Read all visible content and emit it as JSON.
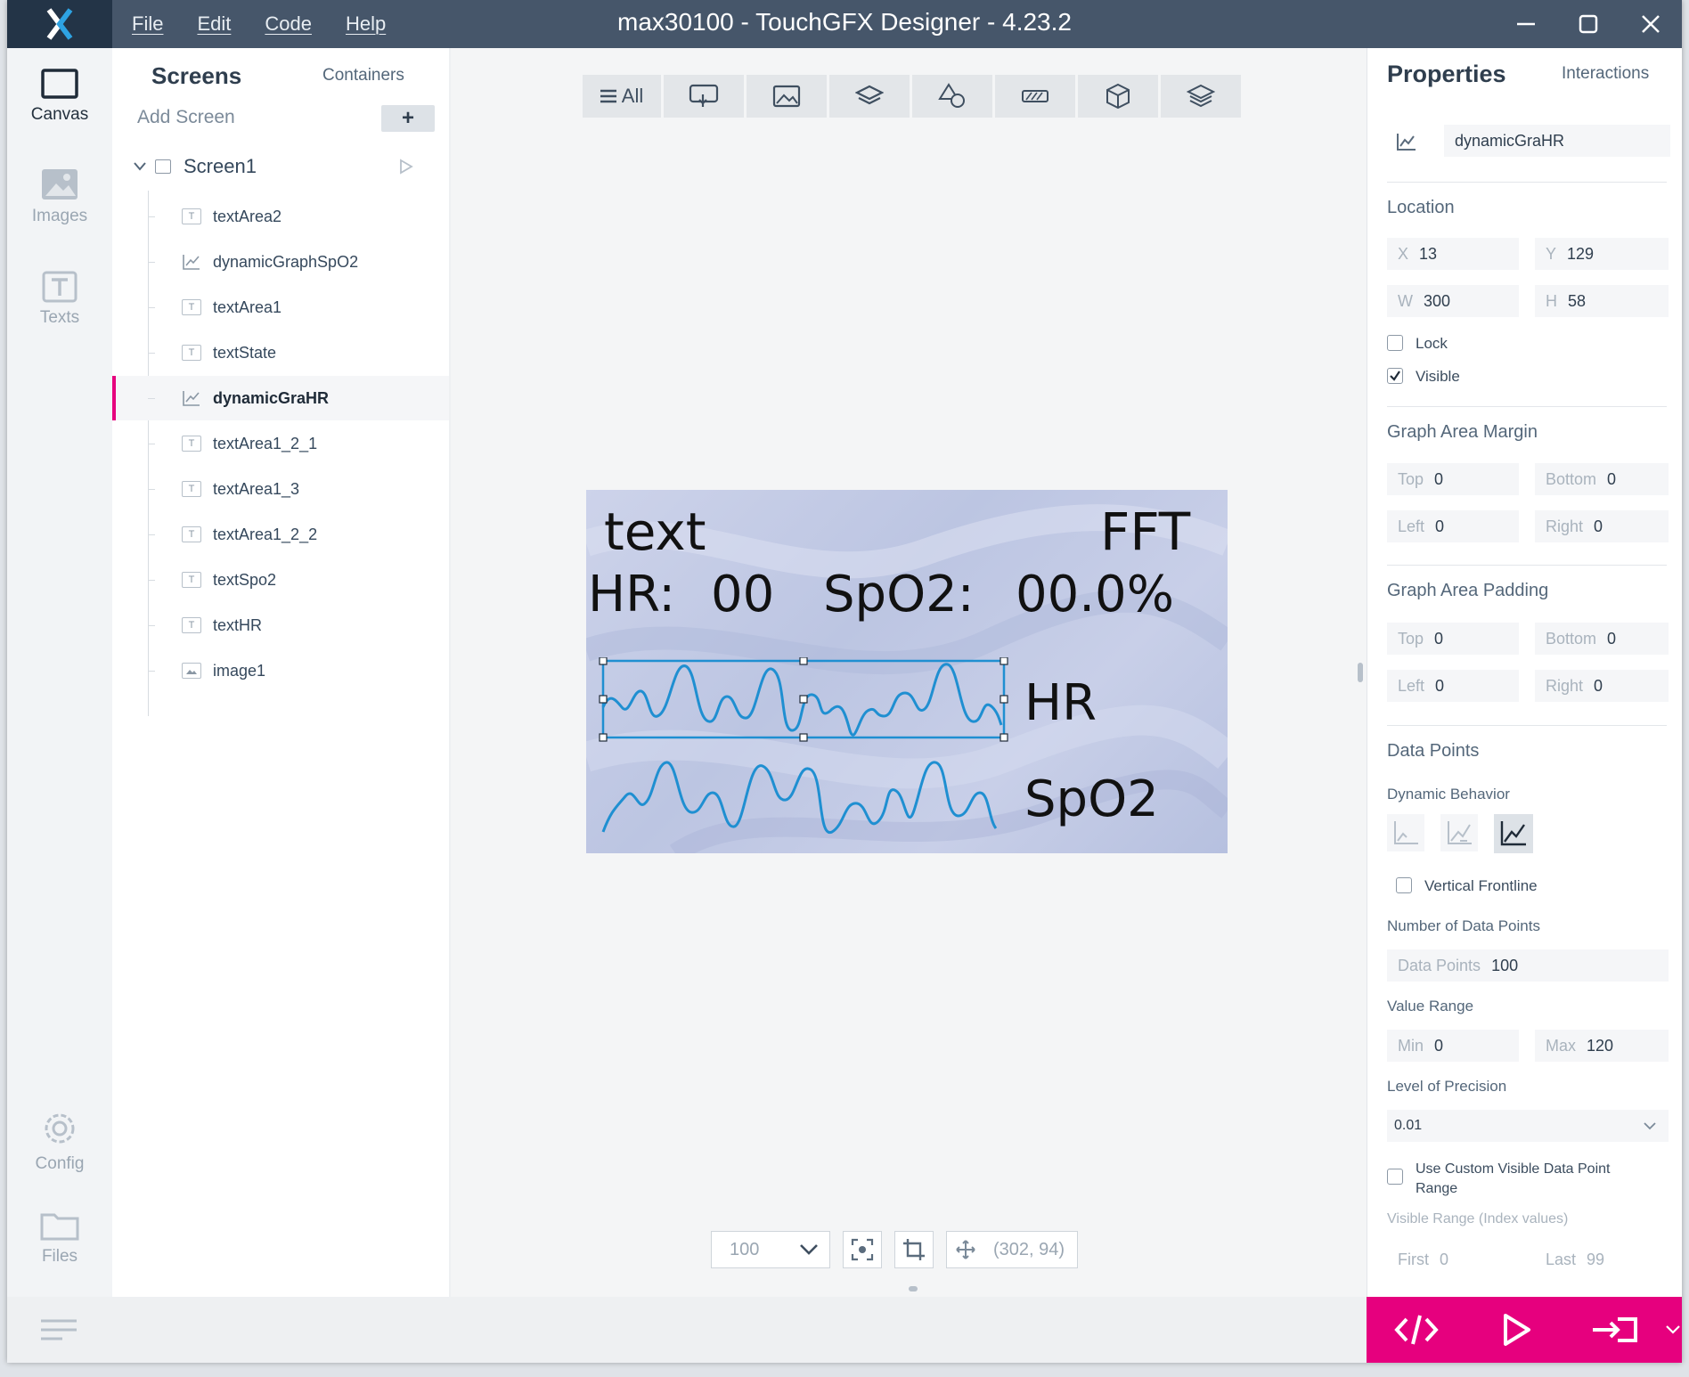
{
  "window": {
    "title": "max30100 - TouchGFX Designer - 4.23.2",
    "menu": [
      "File",
      "Edit",
      "Code",
      "Help"
    ]
  },
  "rail": {
    "canvas": "Canvas",
    "images": "Images",
    "texts": "Texts",
    "config": "Config",
    "files": "Files"
  },
  "screens_panel": {
    "tab_screens": "Screens",
    "tab_containers": "Containers",
    "add_screen": "Add Screen",
    "add_button": "+",
    "screen_name": "Screen1",
    "widgets": [
      {
        "name": "textArea2",
        "type": "text"
      },
      {
        "name": "dynamicGraphSpO2",
        "type": "graph"
      },
      {
        "name": "textArea1",
        "type": "text"
      },
      {
        "name": "textState",
        "type": "text"
      },
      {
        "name": "dynamicGraHR",
        "type": "graph"
      },
      {
        "name": "textArea1_2_1",
        "type": "text"
      },
      {
        "name": "textArea1_3",
        "type": "text"
      },
      {
        "name": "textArea1_2_2",
        "type": "text"
      },
      {
        "name": "textSpo2",
        "type": "text"
      },
      {
        "name": "textHR",
        "type": "text"
      },
      {
        "name": "image1",
        "type": "image"
      }
    ],
    "selected": "dynamicGraHR"
  },
  "canvas": {
    "filter_all": "All",
    "screen_texts": {
      "text": "text",
      "fft": "FFT",
      "hr_label": "HR:",
      "hr_value": "00",
      "spo2_label": "SpO2:",
      "spo2_value": "00.0%",
      "hr_graph_label": "HR",
      "spo2_graph_label": "SpO2"
    },
    "zoom": "100",
    "cursor": "(302, 94)"
  },
  "properties": {
    "tab_properties": "Properties",
    "tab_interactions": "Interactions",
    "widget_name": "dynamicGraHR",
    "location": {
      "title": "Location",
      "x_label": "X",
      "x": "13",
      "y_label": "Y",
      "y": "129",
      "w_label": "W",
      "w": "300",
      "h_label": "H",
      "h": "58",
      "lock": "Lock",
      "visible": "Visible"
    },
    "margin": {
      "title": "Graph Area Margin",
      "top_label": "Top",
      "top": "0",
      "bottom_label": "Bottom",
      "bottom": "0",
      "left_label": "Left",
      "left": "0",
      "right_label": "Right",
      "right": "0"
    },
    "padding": {
      "title": "Graph Area Padding",
      "top_label": "Top",
      "top": "0",
      "bottom_label": "Bottom",
      "bottom": "0",
      "left_label": "Left",
      "left": "0",
      "right_label": "Right",
      "right": "0"
    },
    "data_points": {
      "title": "Data Points",
      "dynamic_behavior": "Dynamic Behavior",
      "vertical_frontline": "Vertical Frontline",
      "number_title": "Number of Data Points",
      "dp_label": "Data Points",
      "dp": "100",
      "value_range": "Value Range",
      "min_label": "Min",
      "min": "0",
      "max_label": "Max",
      "max": "120",
      "precision_title": "Level of Precision",
      "precision": "0.01",
      "custom_range": "Use Custom Visible Data Point Range",
      "visible_range": "Visible Range (Index values)",
      "first_label": "First",
      "first": "0",
      "last_label": "Last",
      "last": "99"
    }
  },
  "colors": {
    "titlebar": "#46566a",
    "accent": "#e6007e",
    "graph": "#1f8fd1"
  }
}
